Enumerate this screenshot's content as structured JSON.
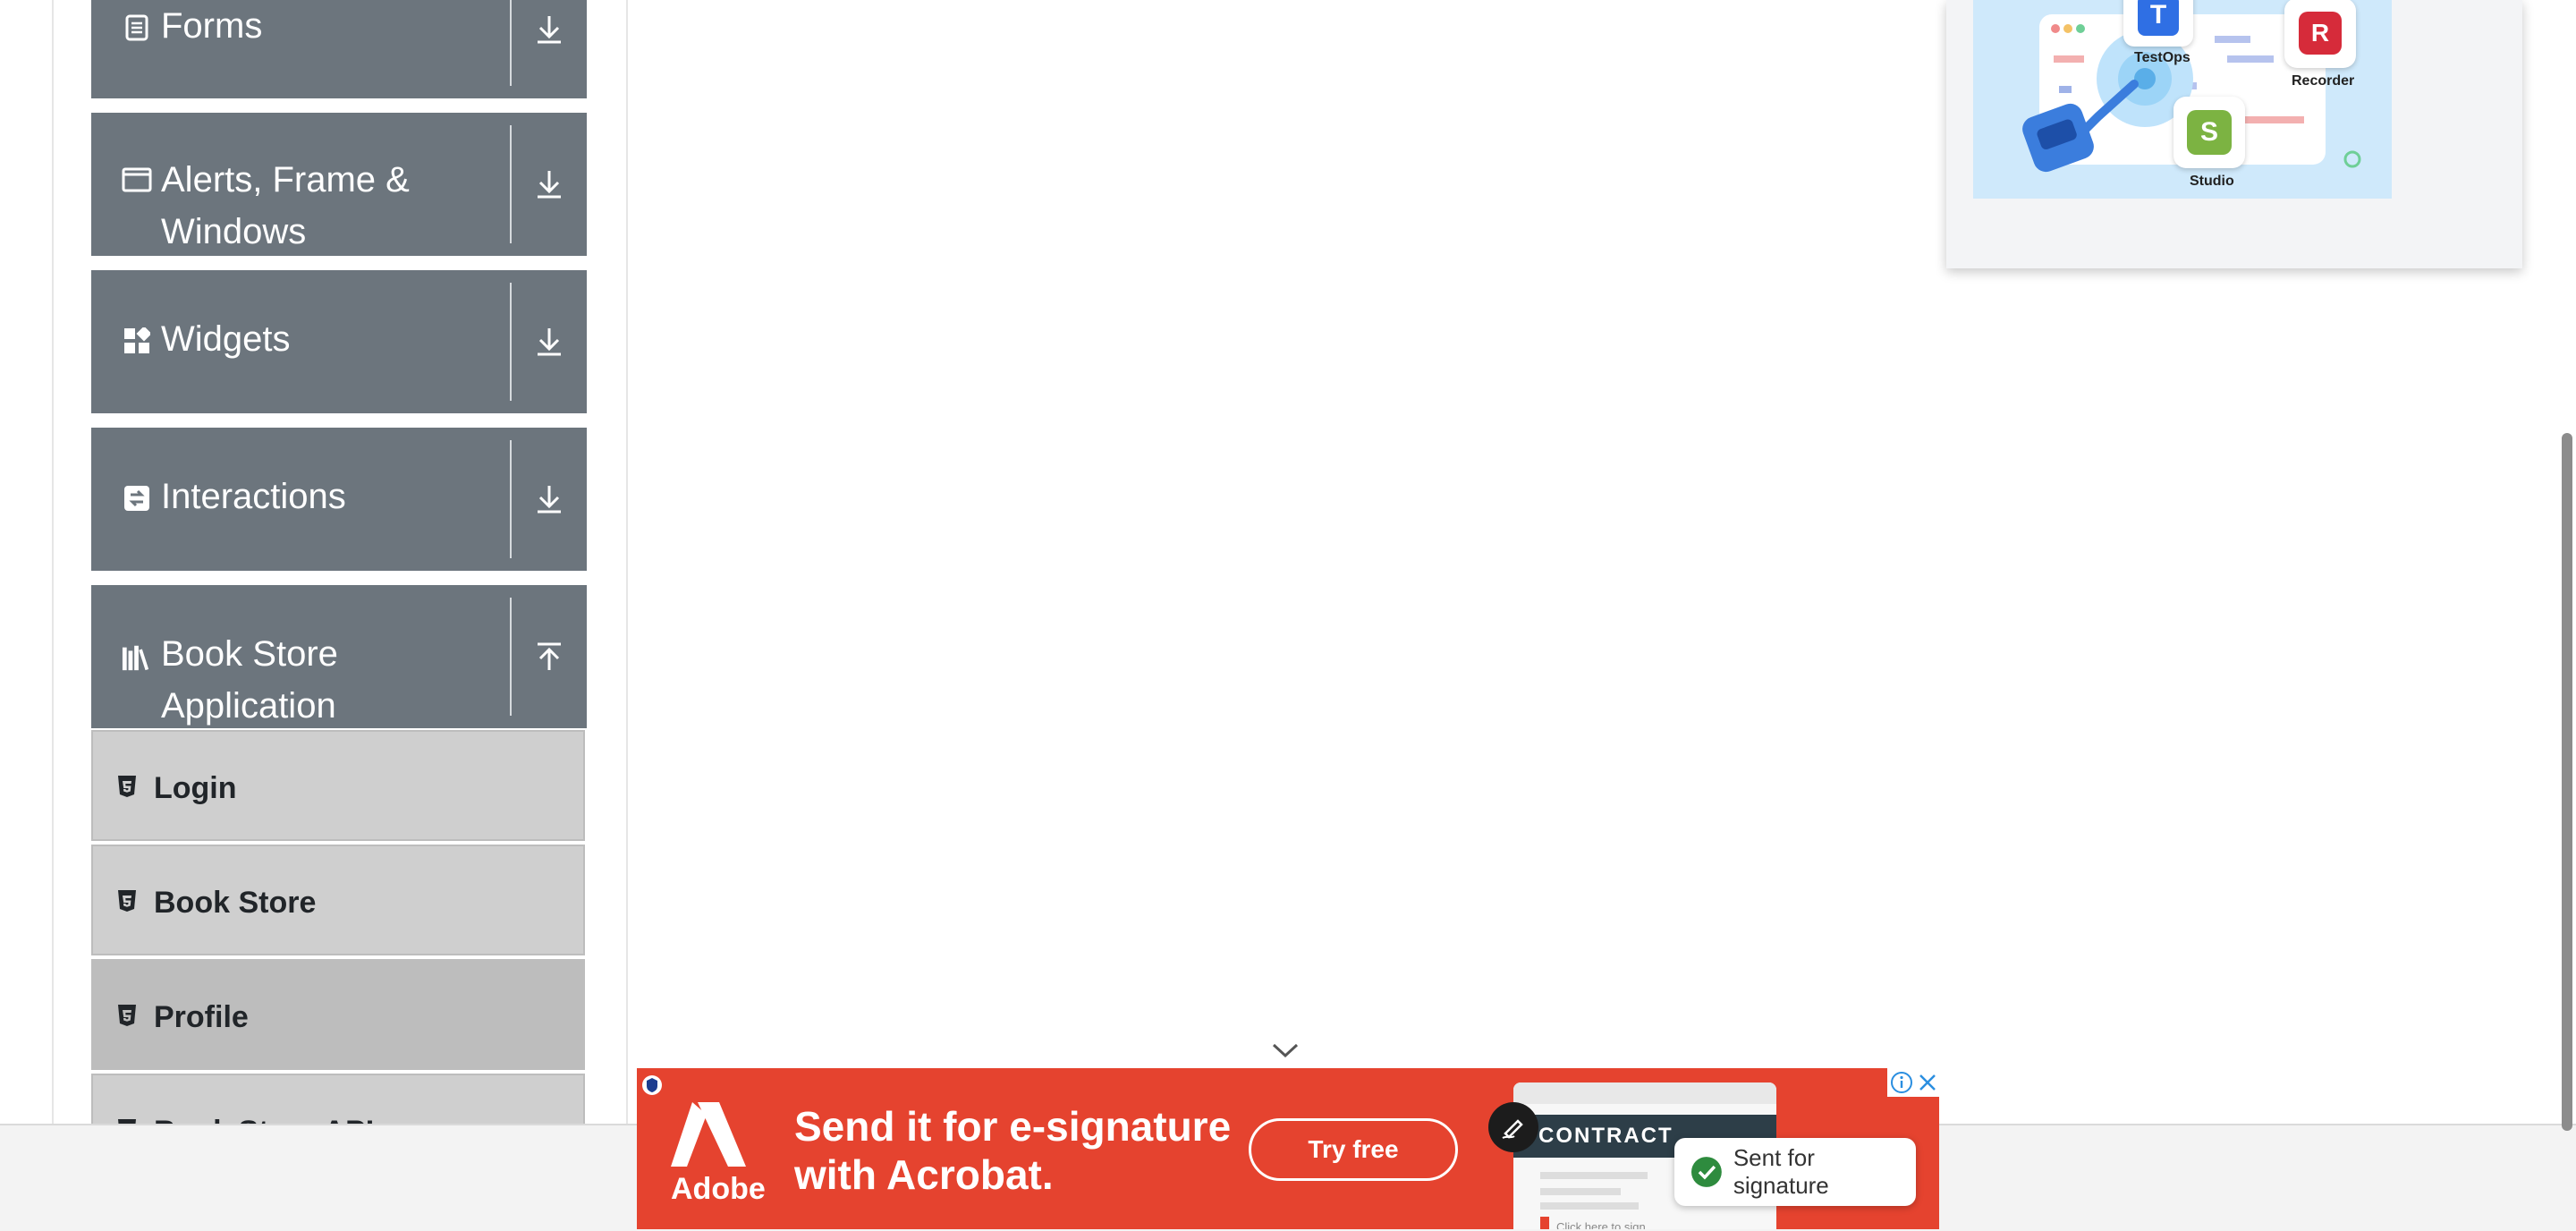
{
  "sidebar": {
    "groups": [
      {
        "label": "Forms",
        "icon": "form-icon",
        "arrow": "download-arrow-icon"
      },
      {
        "label": "Alerts, Frame & Windows",
        "icon": "window-icon",
        "arrow": "download-arrow-icon"
      },
      {
        "label": "Widgets",
        "icon": "widgets-icon",
        "arrow": "download-arrow-icon"
      },
      {
        "label": "Interactions",
        "icon": "interactions-icon",
        "arrow": "download-arrow-icon"
      },
      {
        "label": "Book Store Application",
        "icon": "books-icon",
        "arrow": "upload-arrow-icon",
        "expanded": true
      }
    ],
    "book_store_items": [
      {
        "label": "Login",
        "icon": "html5-icon"
      },
      {
        "label": "Book Store",
        "icon": "html5-icon"
      },
      {
        "label": "Profile",
        "icon": "html5-icon",
        "active": true
      },
      {
        "label": "Book Store API",
        "icon": "html5-icon"
      }
    ]
  },
  "right_ad": {
    "apps": [
      {
        "name": "TestOps",
        "letter": "T",
        "color": "#2f6fe4"
      },
      {
        "name": "Recorder",
        "letter": "R",
        "color": "#d62b3a"
      },
      {
        "name": "Studio",
        "letter": "S",
        "color": "#7cb342"
      }
    ]
  },
  "bottom_ad": {
    "brand": "Adobe",
    "headline_line1": "Send it for e-signature",
    "headline_line2": "with Acrobat.",
    "cta": "Try free",
    "doc_label": "CONTRACT",
    "doc_small": "Click here to sign",
    "badge": "Sent for signature",
    "bg_color": "#e5432f",
    "info_icon": "info-icon",
    "close_icon": "close-icon"
  },
  "colors": {
    "group_bg": "#6c757d",
    "subitem_bg": "#cfcfcf",
    "subitem_active_bg": "#bdbdbd"
  }
}
